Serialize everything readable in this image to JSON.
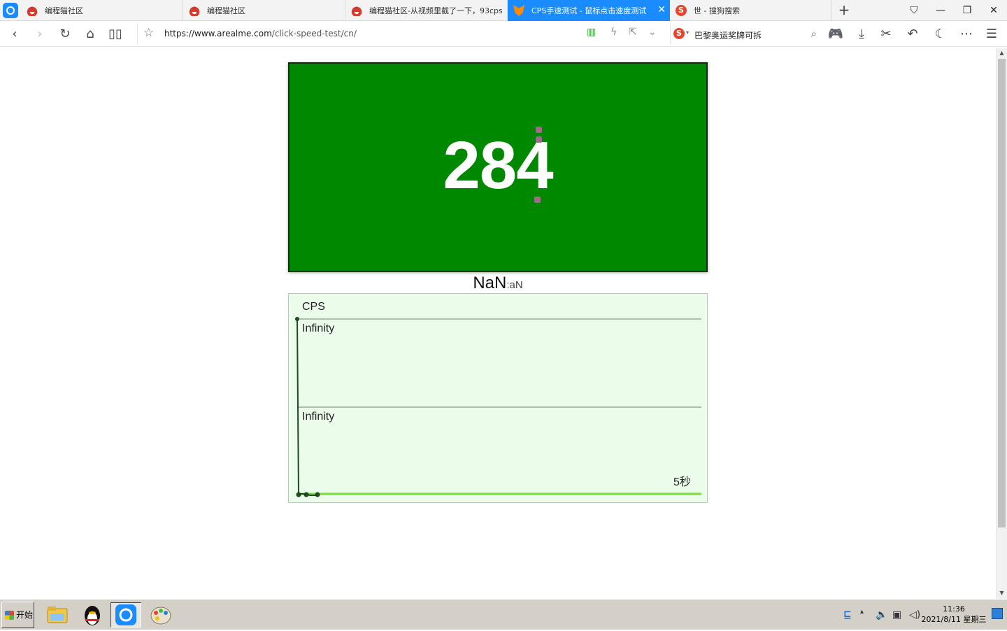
{
  "tabs": [
    {
      "title": "编程猫社区",
      "favicon": "cat-icon",
      "active": false
    },
    {
      "title": "编程猫社区",
      "favicon": "cat-icon",
      "active": false
    },
    {
      "title": "编程猫社区-从视频里截了一下，93cps",
      "favicon": "cat-icon",
      "active": false
    },
    {
      "title": "CPS手速测试 - 鼠标点击速度测试",
      "favicon": "fox-icon",
      "active": true
    },
    {
      "title": "世 - 搜狗搜索",
      "favicon": "sogou-icon",
      "active": false
    }
  ],
  "address": {
    "url_host": "https://www.arealme.com",
    "url_path": "/click-speed-test/cn/"
  },
  "search": {
    "query": "巴黎奥运奖牌可拆"
  },
  "page": {
    "click_count": "284",
    "rate_main": "NaN",
    "rate_sub": ":aN",
    "graph": {
      "title": "CPS",
      "upper_label": "Infinity",
      "lower_label": "Infinity",
      "x_end_label": "5秒"
    }
  },
  "taskbar": {
    "start_label": "开始",
    "time": "11:36",
    "date": "2021/8/11 星期三"
  },
  "colors": {
    "accent": "#1a8cff",
    "click_area": "#008800",
    "graph_bg": "#ebfceb",
    "progress": "#7ddc3c"
  }
}
